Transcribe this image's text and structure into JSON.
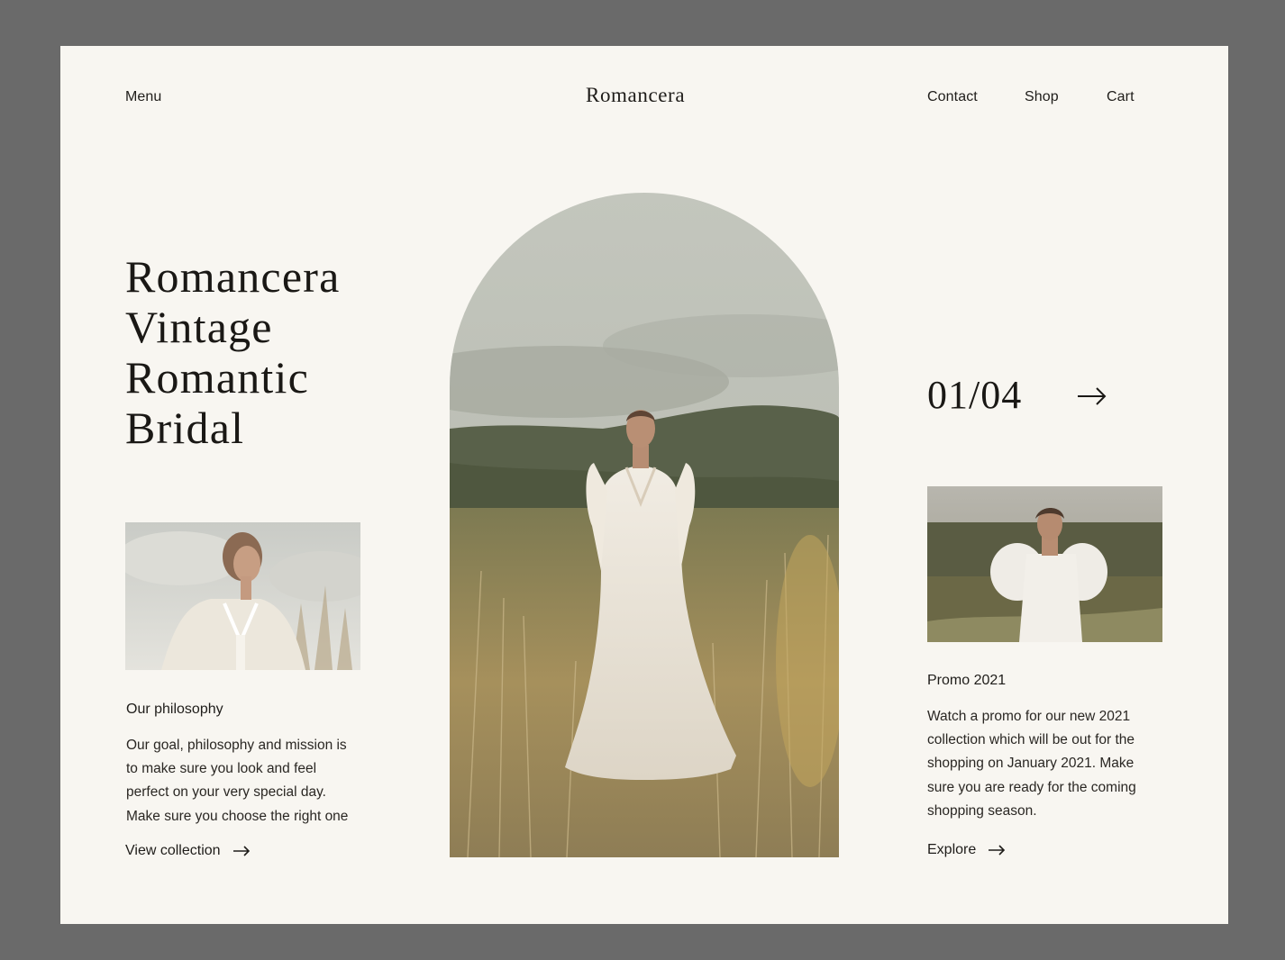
{
  "header": {
    "menu_label": "Menu",
    "logo": "Romancera",
    "nav": [
      {
        "label": "Contact"
      },
      {
        "label": "Shop"
      },
      {
        "label": "Cart"
      }
    ]
  },
  "hero": {
    "title_lines": [
      "Romancera",
      "Vintage",
      "Romantic",
      "Bridal"
    ]
  },
  "philosophy": {
    "heading": "Our philosophy",
    "lines": [
      "Our goal, philosophy and mission is",
      "to make sure you look and feel",
      "perfect on your very special day.",
      "Make sure you choose the right one"
    ],
    "link_label": "View collection"
  },
  "slider": {
    "counter": "01/04",
    "current": 1,
    "total": 4
  },
  "promo": {
    "heading": "Promo 2021",
    "lines": [
      "Watch a promo for our new 2021",
      "collection which will be out for the",
      "shopping on January 2021. Make",
      "sure you are ready for the coming",
      "shopping season."
    ],
    "link_label": "Explore"
  },
  "icons": {
    "arrow": "arrow-right-icon"
  },
  "colors": {
    "page_bg": "#f8f6f1",
    "frame_bg": "#6a6a6a",
    "text": "#1f1d1a"
  }
}
